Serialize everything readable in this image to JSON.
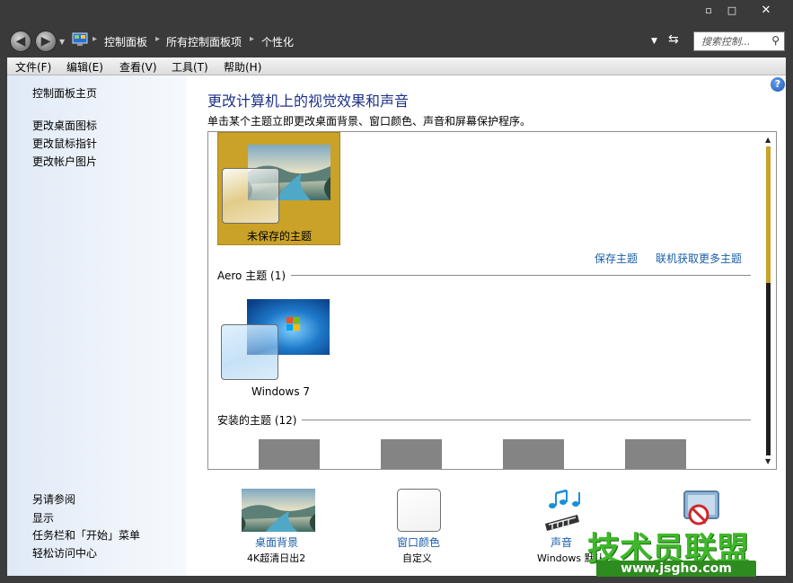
{
  "window": {
    "min_glyph": "▫",
    "max_glyph": "□",
    "close_glyph": "✕"
  },
  "address": {
    "crumbs": [
      "控制面板",
      "所有控制面板项",
      "个性化"
    ],
    "search_placeholder": "搜索控制..."
  },
  "menu": [
    "文件(F)",
    "编辑(E)",
    "查看(V)",
    "工具(T)",
    "帮助(H)"
  ],
  "sidebar": {
    "home": "控制面板主页",
    "tasks": [
      "更改桌面图标",
      "更改鼠标指针",
      "更改帐户图片"
    ],
    "see_also": "另请参阅",
    "see_also_links": [
      "显示",
      "任务栏和「开始」菜单",
      "轻松访问中心"
    ]
  },
  "main": {
    "title": "更改计算机上的视觉效果和声音",
    "subtitle": "单击某个主题立即更改桌面背景、窗口颜色、声音和屏幕保护程序。",
    "unsaved_theme": "未保存的主题",
    "save_theme": "保存主题",
    "get_more": "联机获取更多主题",
    "aero_group": "Aero 主题 (1)",
    "win7_theme": "Windows 7",
    "installed_group": "安装的主题 (12)"
  },
  "bottom": {
    "background_label": "桌面背景",
    "background_value": "4K超清日出2",
    "color_label": "窗口颜色",
    "color_value": "自定义",
    "sound_label": "声音",
    "sound_value": "Windows 默认"
  },
  "watermark": {
    "text": "技术员联盟",
    "url": "www.jsgho.com"
  },
  "colors": {
    "selection": "#c9a227",
    "link": "#1a5ea8",
    "title": "#1e3287"
  },
  "icons": [
    "back-icon",
    "forward-icon",
    "control-panel-icon",
    "refresh-icon",
    "search-icon",
    "help-icon",
    "sound-notes-icon",
    "screensaver-icon"
  ]
}
